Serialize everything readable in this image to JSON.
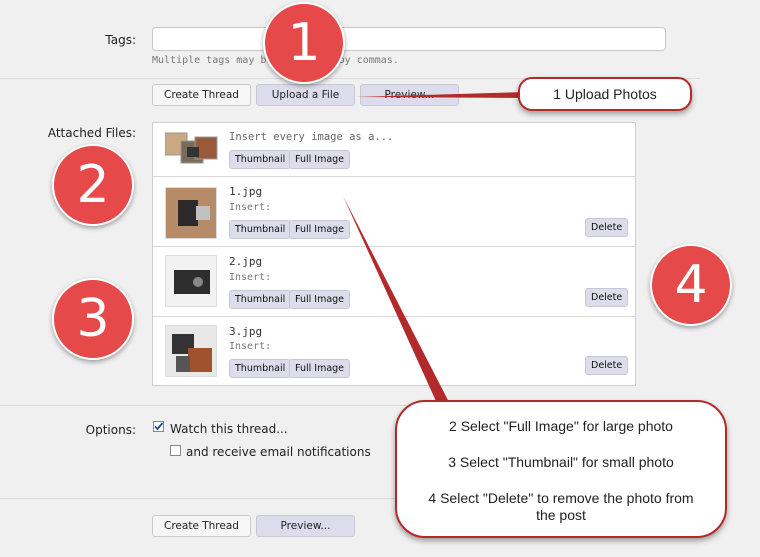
{
  "tags": {
    "label": "Tags:",
    "value": "",
    "hint": "Multiple tags may be separated by commas."
  },
  "top_buttons": {
    "create": "Create Thread",
    "upload": "Upload a File",
    "preview": "Preview..."
  },
  "attached": {
    "label": "Attached Files:",
    "insert_all": {
      "text": "Insert every image as a...",
      "thumbnail": "Thumbnail",
      "full": "Full Image"
    },
    "files": [
      {
        "name": "1.jpg",
        "insert": "Insert:",
        "thumbnail": "Thumbnail",
        "full": "Full Image",
        "delete": "Delete"
      },
      {
        "name": "2.jpg",
        "insert": "Insert:",
        "thumbnail": "Thumbnail",
        "full": "Full Image",
        "delete": "Delete"
      },
      {
        "name": "3.jpg",
        "insert": "Insert:",
        "thumbnail": "Thumbnail",
        "full": "Full Image",
        "delete": "Delete"
      }
    ]
  },
  "options": {
    "label": "Options:",
    "watch": "Watch this thread...",
    "watch_checked": true,
    "email": "and receive email notifications",
    "email_checked": false
  },
  "bottom_buttons": {
    "create": "Create Thread",
    "preview": "Preview..."
  },
  "annotations": {
    "n1": "1",
    "n2": "2",
    "n3": "3",
    "n4": "4",
    "upload_callout": "1 Upload Photos",
    "big_callout": {
      "line1": "2 Select \"Full Image\" for large photo",
      "line2": "3 Select \"Thumbnail\" for small photo",
      "line3": "4 Select \"Delete\" to remove the photo from the post"
    }
  },
  "colors": {
    "marker": "#e5494a",
    "callout_border": "#b32a2a",
    "button": "#dcdcec"
  }
}
